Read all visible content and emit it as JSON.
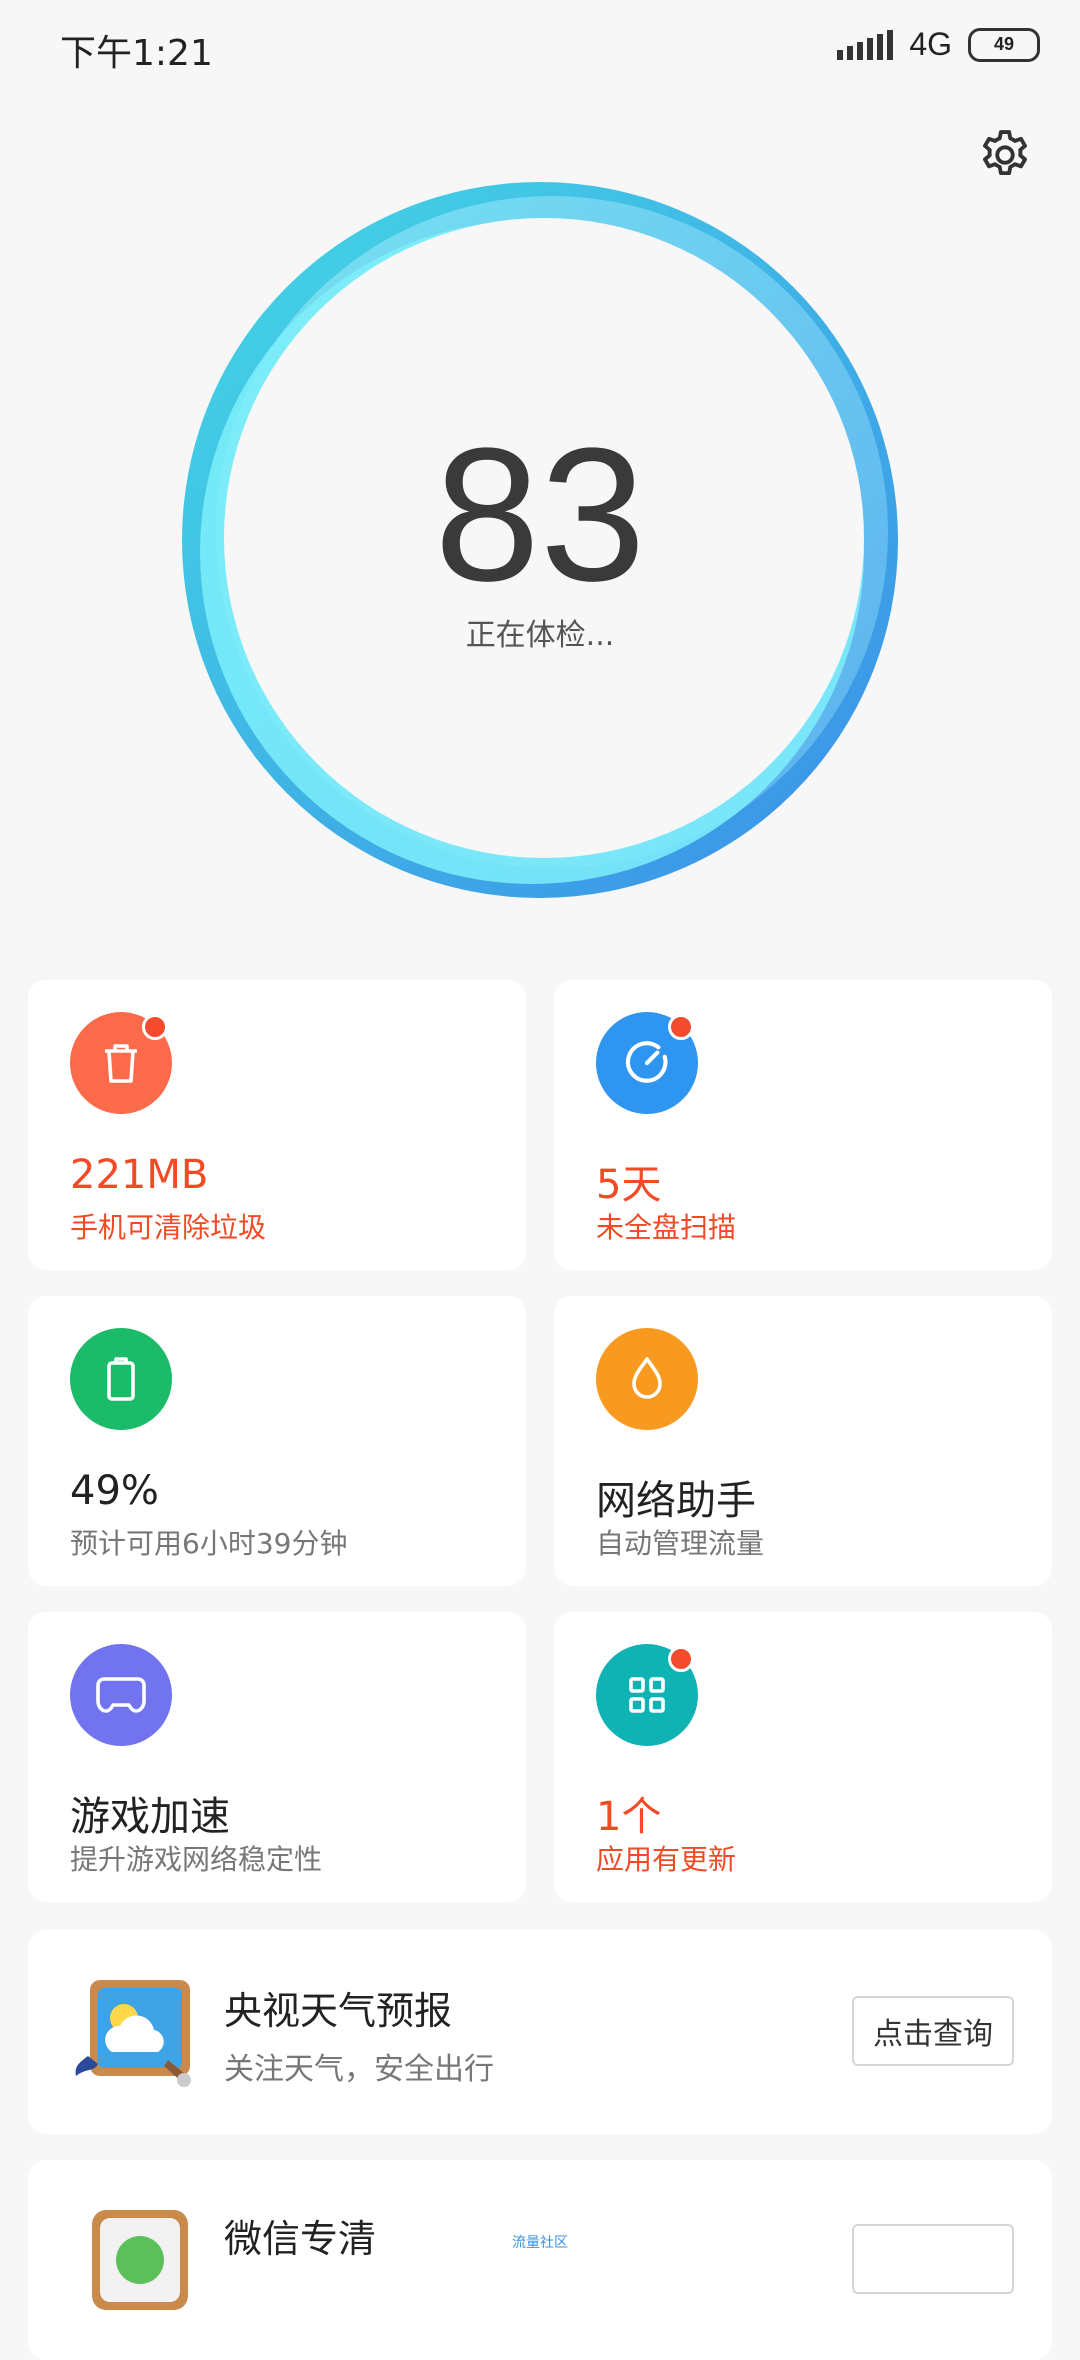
{
  "status_bar": {
    "time": "下午1:21",
    "network": "4G",
    "battery": "49"
  },
  "score": {
    "value": "83",
    "status": "正在体检..."
  },
  "cards": [
    {
      "value": "221MB",
      "desc": "手机可清除垃圾",
      "icon": "trash-icon",
      "color": "#fb6a4b",
      "alert": true,
      "badge": true
    },
    {
      "value": "5天",
      "desc": "未全盘扫描",
      "icon": "speedometer-icon",
      "color": "#2e95f1",
      "alert": true,
      "badge": true
    },
    {
      "value": "49%",
      "desc": "预计可用6小时39分钟",
      "icon": "battery-icon",
      "color": "#1cbb6a",
      "alert": false,
      "badge": false
    },
    {
      "value": "网络助手",
      "desc": "自动管理流量",
      "icon": "droplet-icon",
      "color": "#f99a20",
      "alert": false,
      "badge": false
    },
    {
      "value": "游戏加速",
      "desc": "提升游戏网络稳定性",
      "icon": "gamepad-icon",
      "color": "#7174ee",
      "alert": false,
      "badge": false
    },
    {
      "value": "1个",
      "desc": "应用有更新",
      "icon": "apps-grid-icon",
      "color": "#10b3b3",
      "alert": true,
      "badge": true
    }
  ],
  "promos": [
    {
      "title": "央视天气预报",
      "subtitle": "关注天气，安全出行",
      "button": "点击查询",
      "icon": "weather-app-icon"
    },
    {
      "title": "微信专清",
      "tag": "流量社区",
      "icon": "wechat-clean-icon"
    }
  ]
}
